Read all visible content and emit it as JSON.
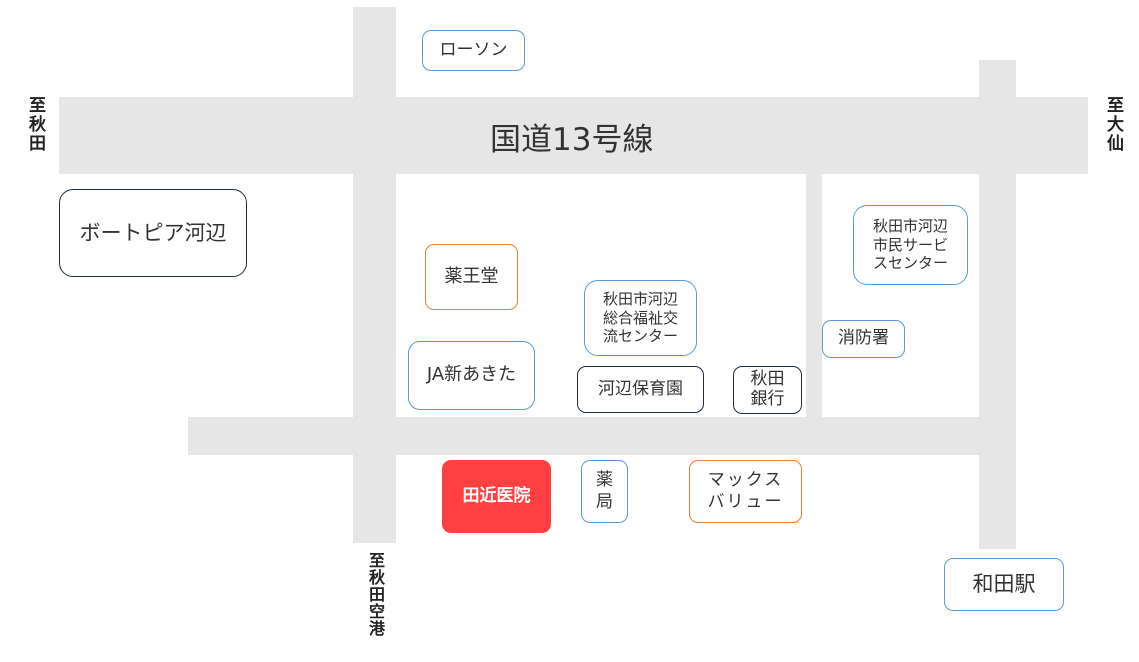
{
  "route": {
    "label": "国道13号線"
  },
  "directions": {
    "west": "至秋田",
    "east": "至大仙",
    "south": "至秋田空港"
  },
  "places": {
    "lawson": "ローソン",
    "boatpia": "ボートピア河辺",
    "yakuodo": "薬王堂",
    "ja": "JA新あきた",
    "welfare_center": [
      "秋田市河辺",
      "総合福祉交",
      "流センター"
    ],
    "service_center": [
      "秋田市河辺",
      "市民サービ",
      "スセンター"
    ],
    "fire_station": "消防署",
    "nursery": "河辺保育園",
    "bank": [
      "秋田",
      "銀行"
    ],
    "clinic": "田近医院",
    "pharmacy": [
      "薬",
      "局"
    ],
    "maxvalu": [
      "マックス",
      "バリュー"
    ],
    "wada_station": "和田駅"
  },
  "colors": {
    "road": "#e6e6e6",
    "clinic": "#ff4040",
    "blue_border": "#5b9bd5",
    "orange_border": "#ed7d31",
    "dark_border": "#1f2d3d"
  }
}
